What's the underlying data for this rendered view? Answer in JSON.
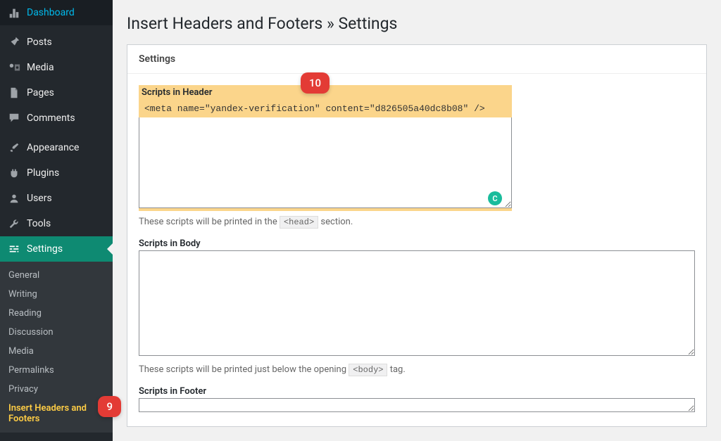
{
  "sidebar": {
    "mainItems": [
      {
        "label": "Dashboard",
        "icon": "dashboard"
      },
      {
        "label": "Posts",
        "icon": "pin"
      },
      {
        "label": "Media",
        "icon": "media"
      },
      {
        "label": "Pages",
        "icon": "page"
      },
      {
        "label": "Comments",
        "icon": "comment"
      },
      {
        "label": "Appearance",
        "icon": "brush"
      },
      {
        "label": "Plugins",
        "icon": "plug"
      },
      {
        "label": "Users",
        "icon": "user"
      },
      {
        "label": "Tools",
        "icon": "wrench"
      },
      {
        "label": "Settings",
        "icon": "sliders",
        "active": true
      }
    ],
    "submenu": [
      {
        "label": "General"
      },
      {
        "label": "Writing"
      },
      {
        "label": "Reading"
      },
      {
        "label": "Discussion"
      },
      {
        "label": "Media"
      },
      {
        "label": "Permalinks"
      },
      {
        "label": "Privacy"
      },
      {
        "label": "Insert Headers and Footers",
        "current": true
      }
    ]
  },
  "page": {
    "title": "Insert Headers and Footers » Settings",
    "panelTitle": "Settings",
    "fields": {
      "header": {
        "label": "Scripts in Header",
        "value": "<meta name=\"yandex-verification\" content=\"d826505a40dc8b08\" />",
        "helpPrefix": "These scripts will be printed in the ",
        "helpCode": "<head>",
        "helpSuffix": " section."
      },
      "body": {
        "label": "Scripts in Body",
        "value": "",
        "helpPrefix": "These scripts will be printed just below the opening ",
        "helpCode": "<body>",
        "helpSuffix": " tag."
      },
      "footer": {
        "label": "Scripts in Footer",
        "value": ""
      }
    },
    "cornerBadge": "C"
  },
  "annotations": {
    "badge9": "9",
    "badge10": "10"
  }
}
